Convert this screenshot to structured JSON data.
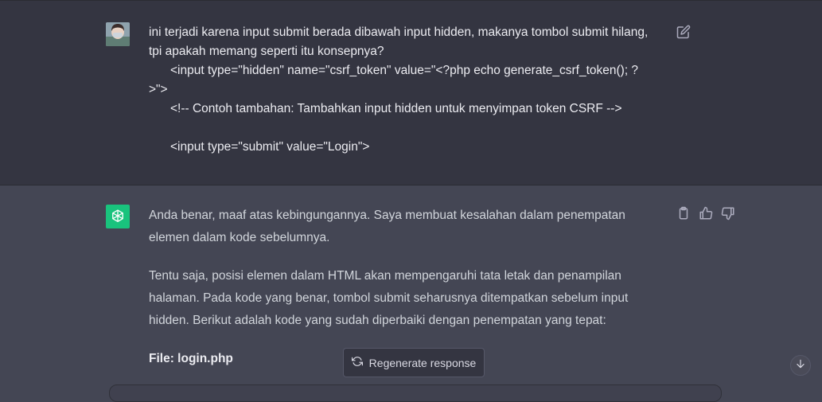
{
  "user_message": {
    "line1": "ini terjadi karena input submit berada dibawah input hidden, makanya tombol submit hilang,",
    "line2": "tpi apakah memang seperti itu konsepnya?",
    "code1a": "<input type=\"hidden\" name=\"csrf_token\" value=\"<?php echo generate_csrf_token(); ?",
    "code1b": ">\">",
    "code2": "<!-- Contoh tambahan: Tambahkan input hidden untuk menyimpan token CSRF -->",
    "code3": "<input type=\"submit\" value=\"Login\">"
  },
  "assistant_message": {
    "para1": "Anda benar, maaf atas kebingungannya. Saya membuat kesalahan dalam penempatan elemen dalam kode sebelumnya.",
    "para2": "Tentu saja, posisi elemen dalam HTML akan mempengaruhi tata letak dan penampilan halaman. Pada kode yang benar, tombol submit seharusnya ditempatkan sebelum input hidden. Berikut adalah kode yang sudah diperbaiki dengan penempatan yang tepat:",
    "file_label": "File: login.php"
  },
  "regenerate_label": "Regenerate response",
  "icons": {
    "edit": "edit-icon",
    "copy": "clipboard-icon",
    "like": "thumbs-up-icon",
    "dislike": "thumbs-down-icon",
    "regen": "refresh-icon",
    "scroll": "arrow-down-icon"
  },
  "colors": {
    "user_bg": "#343541",
    "assistant_bg": "#444654",
    "gpt_green": "#19c37d"
  }
}
